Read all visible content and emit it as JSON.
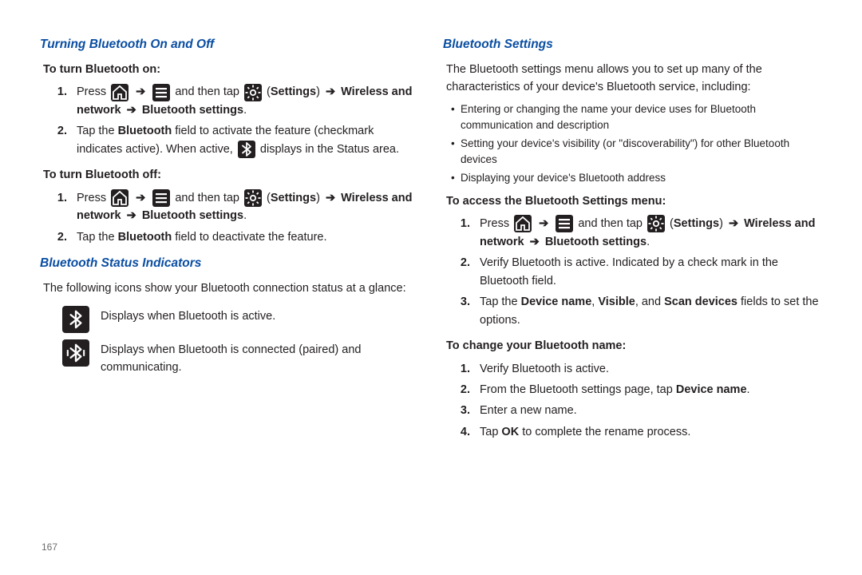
{
  "pageNumber": "167",
  "left": {
    "h1": "Turning Bluetooth On and Off",
    "onHead": "To turn Bluetooth on:",
    "onSteps": [
      {
        "n": "1.",
        "pre": "Press ",
        "mid": " and then tap ",
        "settings": "Settings",
        "tail": "Wireless and network",
        "tail2": "Bluetooth settings",
        "post": "."
      },
      {
        "n": "2.",
        "text1": "Tap the ",
        "bold1": "Bluetooth",
        "text2": " field to activate the feature (checkmark indicates active). When active, ",
        "text3": " displays in the Status area."
      }
    ],
    "offHead": "To turn Bluetooth off:",
    "offSteps": [
      {
        "n": "1.",
        "pre": "Press ",
        "mid": " and then tap ",
        "settings": "Settings",
        "tail": "Wireless and network",
        "tail2": "Bluetooth settings",
        "post": "."
      },
      {
        "n": "2.",
        "text1": "Tap the ",
        "bold1": "Bluetooth",
        "text2": " field to deactivate the feature."
      }
    ],
    "h2": "Bluetooth Status Indicators",
    "indIntro": "The following icons show your Bluetooth connection status at a glance:",
    "indRows": [
      {
        "text": "Displays when Bluetooth is active."
      },
      {
        "text": "Displays when Bluetooth is connected (paired) and communicating."
      }
    ]
  },
  "right": {
    "h1": "Bluetooth Settings",
    "intro": "The Bluetooth settings menu allows you to set up many of the characteristics of your device's Bluetooth service, including:",
    "bullets": [
      "Entering or changing the name your device uses for Bluetooth communication and description",
      "Setting your device's visibility (or \"discoverability\") for other Bluetooth devices",
      "Displaying your device's Bluetooth address"
    ],
    "accessHead": "To access the Bluetooth Settings menu:",
    "accessSteps": [
      {
        "n": "1.",
        "pre": "Press ",
        "mid": " and then tap ",
        "settings": "Settings",
        "tail": "Wireless and network",
        "tail2": "Bluetooth settings",
        "post": "."
      },
      {
        "n": "2.",
        "text": "Verify Bluetooth is active. Indicated by a check mark in the Bluetooth field."
      },
      {
        "n": "3.",
        "t1": "Tap the ",
        "b1": "Device name",
        "t2": ", ",
        "b2": "Visible",
        "t3": ", and ",
        "b3": "Scan devices",
        "t4": " fields to set the options."
      }
    ],
    "changeHead": "To change your Bluetooth name:",
    "changeSteps": [
      {
        "n": "1.",
        "text": "Verify Bluetooth is active."
      },
      {
        "n": "2.",
        "t1": "From the Bluetooth settings page, tap ",
        "b1": "Device name",
        "t2": "."
      },
      {
        "n": "3.",
        "text": "Enter a new name."
      },
      {
        "n": "4.",
        "t1": "Tap ",
        "b1": "OK",
        "t2": " to complete the rename process."
      }
    ]
  }
}
